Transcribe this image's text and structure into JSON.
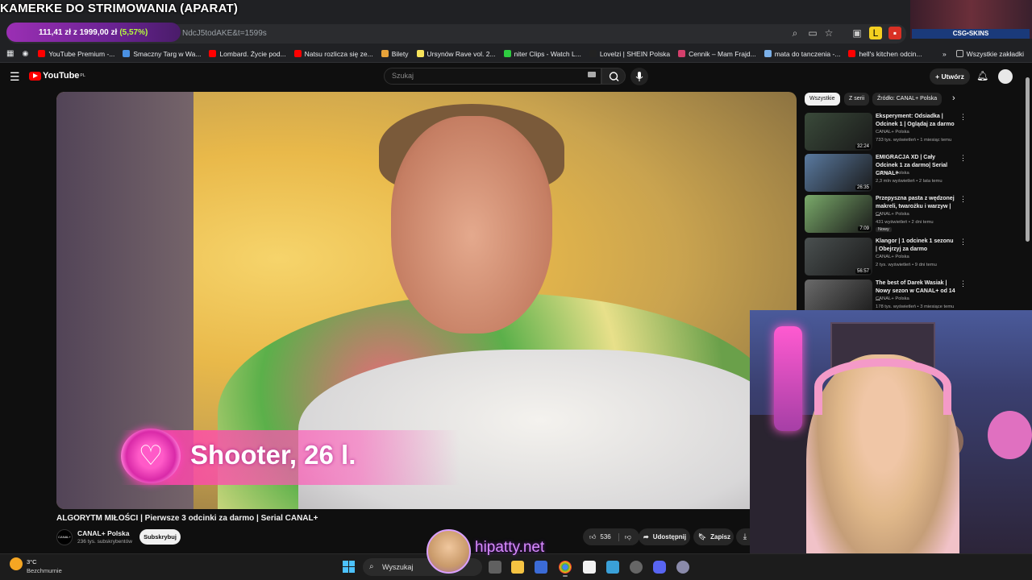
{
  "overlay": {
    "title": "KAMERKE DO STRIMOWANIA (APARAT)",
    "goal_amount": "111,41 zł z 1999,00 zł",
    "goal_percent": "(5,57%)"
  },
  "browser": {
    "address": "NdcJ5todAKE&t=1599s",
    "bookmarks": [
      {
        "label": "YouTube Premium -...",
        "color": "#ff0000"
      },
      {
        "label": "Smaczny Targ w Wa...",
        "color": "#4a90e2"
      },
      {
        "label": "Lombard. Życie pod...",
        "color": "#ff0000"
      },
      {
        "label": "Natsu rozlicza się ze...",
        "color": "#ff0000"
      },
      {
        "label": "Bilety",
        "color": "#e8a33a"
      },
      {
        "label": "Ursynów Rave vol. 2...",
        "color": "#f7e35a"
      },
      {
        "label": "niter Clips - Watch L...",
        "color": "#2ecc40"
      },
      {
        "label": "Lovelzi | SHEIN Polska",
        "color": "#222222"
      },
      {
        "label": "Cennik – Mam Frajd...",
        "color": "#d43f6c"
      },
      {
        "label": "mata do tanczenia -...",
        "color": "#7bb0e8"
      },
      {
        "label": "hell's kitchen odcin...",
        "color": "#ff0000"
      }
    ],
    "all_bookmarks_label": "Wszystkie zakładki"
  },
  "stream_badge": "CSG•SKINS",
  "youtube": {
    "logo_text": "YouTube",
    "logo_region": "PL",
    "search_placeholder": "Szukaj",
    "create_label": "Utwórz"
  },
  "video": {
    "caption": "Shooter, 26 l.",
    "title": "ALGORYTM MIŁOŚCI | Pierwsze 3 odcinki za darmo | Serial CANAL+",
    "channel_name": "CANAL+ Polska",
    "channel_avatar_text": "CANAL+",
    "subscribers": "236 tys. subskrybentów",
    "subscribe_label": "Subskrybuj",
    "likes": "536",
    "share_label": "Udostępnij",
    "save_label": "Zapisz"
  },
  "chips": [
    {
      "label": "Wszystkie",
      "active": true
    },
    {
      "label": "Z serii",
      "active": false
    },
    {
      "label": "Źródło: CANAL+ Polska",
      "active": false
    }
  ],
  "recommendations": [
    {
      "title": "Eksperyment: Odsiadka | Odcinek 1 | Oglądaj za darmo",
      "channel": "CANAL+ Polska",
      "meta": "733 tys. wyświetleń • 1 miesiąc temu",
      "duration": "32:24",
      "thumb": "#3a4a3a"
    },
    {
      "title": "EMIGRACJA XD | Cały Odcinek 1 za darmo| Serial CANAL+",
      "channel": "CANAL+ Polska",
      "meta": "2,3 mln wyświetleń • 2 lata temu",
      "duration": "26:35",
      "thumb": "#5a7aa0"
    },
    {
      "title": "Przepyszna pasta z wędzonej makreli, twarożku i warzyw | ...",
      "channel": "CANAL+ Polska",
      "meta": "431 wyświetleń • 2 dni temu",
      "duration": "7:09",
      "badge": "Nowy",
      "thumb": "#7aaa6a"
    },
    {
      "title": "Klangor | 1 odcinek 1 sezonu | Obejrzyj za darmo",
      "channel": "CANAL+ Polska",
      "meta": "2 tys. wyświetleń • 9 dni temu",
      "duration": "56:57",
      "thumb": "#4a5050"
    },
    {
      "title": "The best of Darek Wasiak | Nowy sezon w CANAL+ od 14 ...",
      "channel": "CANAL+ Polska",
      "meta": "178 tys. wyświetleń • 3 miesiące temu",
      "duration": "",
      "thumb": "#6a6a6a"
    }
  ],
  "watermark": "hipatty.net",
  "taskbar": {
    "temperature": "3°C",
    "weather": "Bezchmurnie",
    "search_label": "Wyszukaj"
  }
}
